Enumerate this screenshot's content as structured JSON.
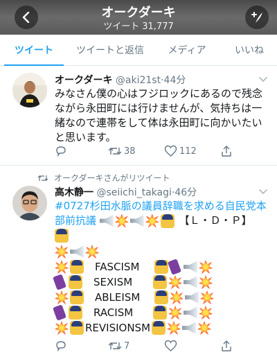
{
  "header": {
    "title": "オークダーキ",
    "subtitle_label": "ツイート",
    "subtitle_count": "31,777"
  },
  "tabs": [
    {
      "label": "ツイート",
      "active": true
    },
    {
      "label": "ツイートと返信",
      "active": false
    },
    {
      "label": "メディア",
      "active": false
    },
    {
      "label": "いいね",
      "active": false
    }
  ],
  "tweets": [
    {
      "name": "オークダーキ",
      "handle": "@aki21st",
      "time": "44分",
      "text": "みなさん僕の心はフジロックにあるので残念ながら永田町には行けませんが、気持ちは一緒なので連帯をして体は永田町に向かいたいと思います。",
      "retweets": "38",
      "likes": "112"
    },
    {
      "retweeted_by": "オークダーキさんがリツイート",
      "name": "高木静一",
      "handle": "@seiichi_takagi",
      "time": "46分",
      "hashtag": "#0727杉田水脈の議員辞職を求める自民党本部前抗議",
      "ldp": "【Ｌ・Ｄ・Ｐ】",
      "words": [
        "FASCISM",
        "SEXISM",
        "ABLEISM",
        "RACISM",
        "REVISIONSM"
      ],
      "retweets": "7"
    }
  ],
  "icons": {
    "back": "chevron-left-icon",
    "compose": "compose-plus-icon",
    "reply": "reply-icon",
    "retweet": "retweet-icon",
    "like": "heart-icon",
    "share": "share-icon",
    "caret": "chevron-down-icon"
  },
  "colors": {
    "accent": "#1da1f2",
    "secondary_text": "#657786",
    "divider": "#e1e8ed"
  }
}
